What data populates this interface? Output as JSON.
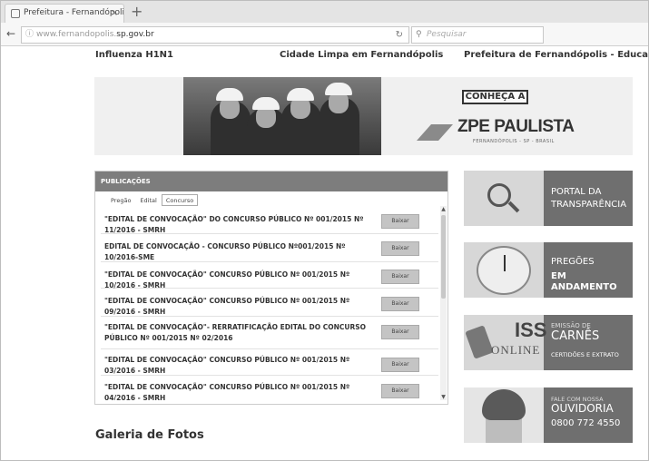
{
  "browser": {
    "tab_title": "Prefeitura - Fernandópolis...",
    "tab_close": "×",
    "new_tab": "+",
    "url_prefix": "www.fernandopolis.",
    "url_domain": "sp.gov.br",
    "search_placeholder": "Pesquisar"
  },
  "top_links": [
    "Influenza H1N1",
    "Cidade Limpa em Fernandópolis",
    "Prefeitura de Fernandópolis - Educação"
  ],
  "banner": {
    "cta": "CONHEÇA A",
    "brand": "ZPE PAULISTA",
    "subtitle": "FERNANDÓPOLIS - SP - BRASIL"
  },
  "publicacoes": {
    "title": "PUBLICAÇÕES",
    "tabs": [
      "Pregão",
      "Edital",
      "Concurso"
    ],
    "active_tab": "Concurso",
    "button_label": "Baixar",
    "rows": [
      "\"EDITAL DE CONVOCAÇÃO\" DO CONCURSO PÚBLICO Nº 001/2015 Nº 11/2016 - SMRH",
      "EDITAL DE CONVOCAÇÃO - CONCURSO PÚBLICO Nº001/2015 Nº 10/2016-SME",
      "\"EDITAL DE CONVOCAÇÃO\" CONCURSO PÚBLICO Nº 001/2015 Nº 10/2016 - SMRH",
      "\"EDITAL DE CONVOCAÇÃO\" CONCURSO PÚBLICO Nº 001/2015 Nº 09/2016 - SMRH",
      "\"EDITAL DE CONVOCAÇÃO\"- RERRATIFICAÇÃO EDITAL DO CONCURSO PÚBLICO Nº 001/2015 Nº 02/2016",
      "\"EDITAL DE CONVOCAÇÃO\" CONCURSO PÚBLICO Nº 001/2015 Nº 03/2016 - SMRH",
      "\"EDITAL DE CONVOCAÇÃO\" CONCURSO PÚBLICO Nº 001/2015 Nº 04/2016 - SMRH"
    ]
  },
  "side_banners": {
    "portal": {
      "line1": "PORTAL DA",
      "line2": "TRANSPARÊNCIA"
    },
    "pregoes": {
      "line1": "PREGÕES",
      "line2": "EM ANDAMENTO"
    },
    "iss": {
      "iss": "ISS",
      "online": "ONLINE",
      "line0": "EMISSÃO DE",
      "line1": "CARNÊS",
      "line2": "CERTIDÕES E EXTRATO"
    },
    "ouvidoria": {
      "line0": "FALE COM NOSSA",
      "line1": "OUVIDORIA",
      "line2": "0800 772 4550"
    }
  },
  "galeria_title": "Galeria de Fotos"
}
